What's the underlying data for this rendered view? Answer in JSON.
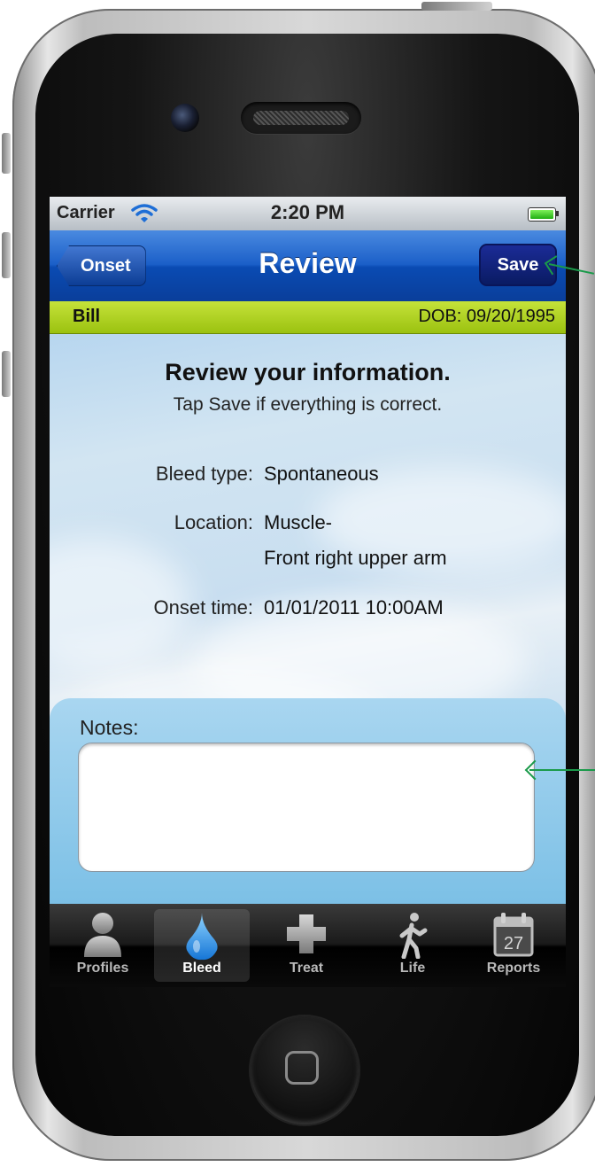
{
  "status_bar": {
    "carrier": "Carrier",
    "time": "2:20 PM"
  },
  "nav_bar": {
    "back_label": "Onset",
    "title": "Review",
    "save_label": "Save"
  },
  "patient": {
    "name": "Bill",
    "dob": "DOB: 09/20/1995"
  },
  "review": {
    "heading": "Review your information.",
    "subheading": "Tap Save if everything is correct.",
    "fields": [
      {
        "label": "Bleed type:",
        "values": [
          "Spontaneous"
        ]
      },
      {
        "label": "Location:",
        "values": [
          "Muscle-",
          "Front right upper arm"
        ]
      },
      {
        "label": "Onset time:",
        "values": [
          "01/01/2011 10:00AM"
        ]
      }
    ]
  },
  "notes": {
    "label": "Notes:",
    "value": ""
  },
  "tab_bar": {
    "tabs": [
      {
        "label": "Profiles",
        "icon": "person-icon",
        "active": false
      },
      {
        "label": "Bleed",
        "icon": "drop-icon",
        "active": true
      },
      {
        "label": "Treat",
        "icon": "cross-icon",
        "active": false
      },
      {
        "label": "Life",
        "icon": "walking-person-icon",
        "active": false
      },
      {
        "label": "Reports",
        "icon": "calendar-icon",
        "active": false,
        "badge": "27"
      }
    ]
  },
  "colors": {
    "nav_blue": "#1b5fc8",
    "patient_bar_green": "#b4d420",
    "annotation_arrow": "#1a9a4a"
  }
}
